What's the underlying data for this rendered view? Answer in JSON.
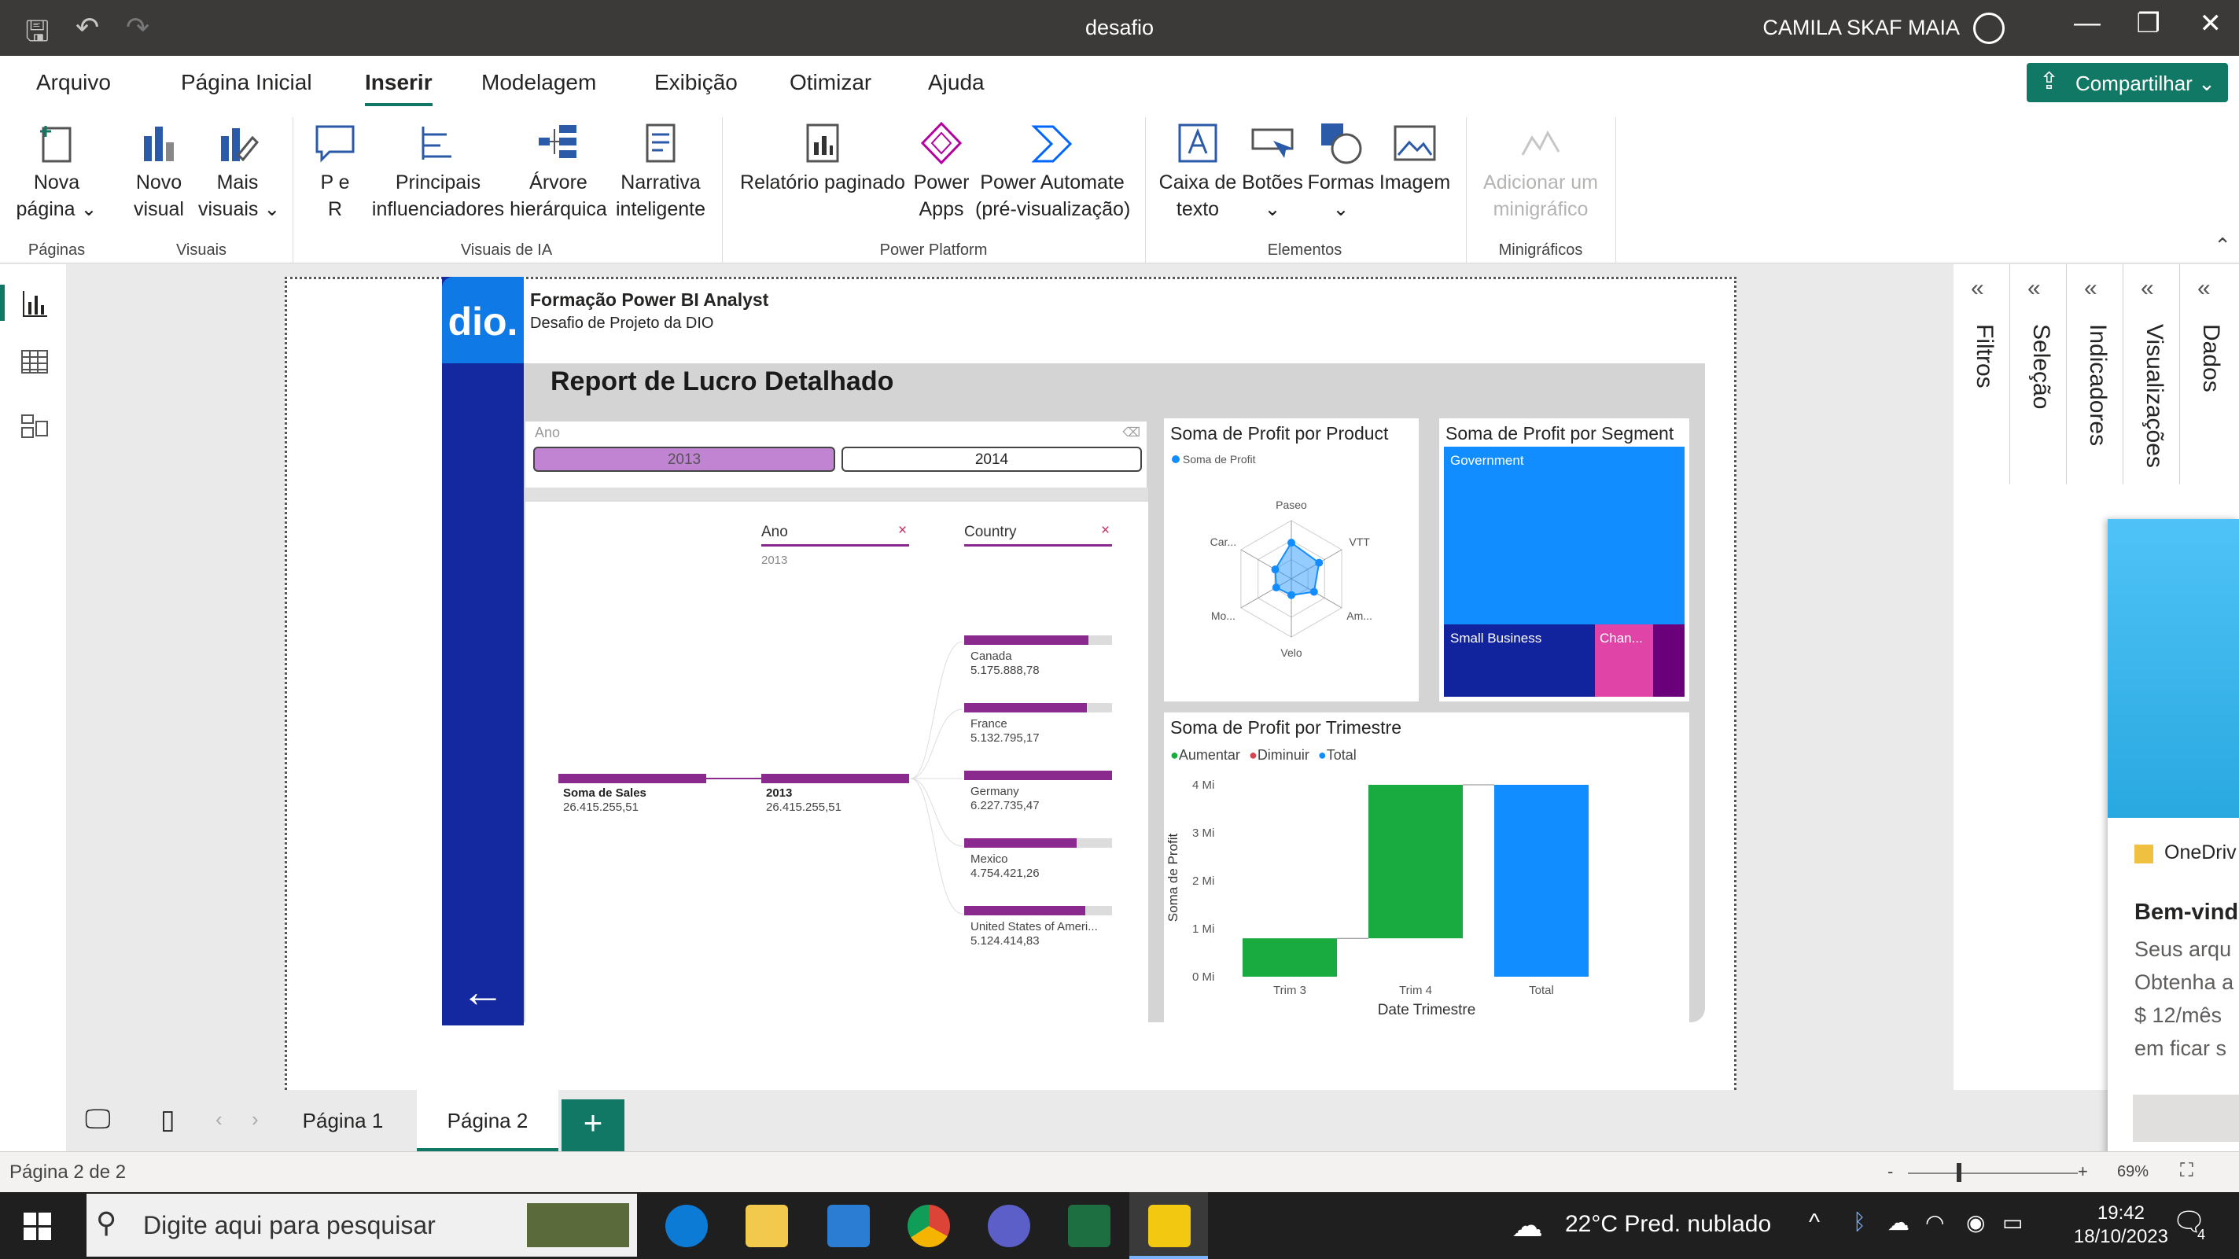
{
  "titlebar": {
    "title": "desafio",
    "user": "CAMILA SKAF MAIA"
  },
  "menu": {
    "tabs": [
      "Arquivo",
      "Página Inicial",
      "Inserir",
      "Modelagem",
      "Exibição",
      "Otimizar",
      "Ajuda"
    ],
    "active": "Inserir",
    "share_label": "Compartilhar"
  },
  "ribbon": {
    "nova_pagina": "Nova\npágina ⌄",
    "novo_visual": "Novo\nvisual",
    "mais_visuais": "Mais\nvisuais ⌄",
    "pe_r": "P e\nR",
    "principais": "Principais\ninfluenciadores",
    "arvore": "Árvore\nhierárquica",
    "narrativa": "Narrativa\ninteligente",
    "relatorio": "Relatório paginado",
    "power_apps": "Power\nApps",
    "power_automate": "Power Automate\n(pré-visualização)",
    "caixa_texto": "Caixa de\ntexto",
    "botoes": "Botões\n⌄",
    "formas": "Formas\n⌄",
    "imagem": "Imagem",
    "minigrafico": "Adicionar um\nminigráfico",
    "groups": {
      "paginas": "Páginas",
      "visuais": "Visuais",
      "visuais_ia": "Visuais de IA",
      "power_platform": "Power Platform",
      "elementos": "Elementos",
      "minigraficos": "Minigráficos"
    }
  },
  "report": {
    "logo": "dio.",
    "header_title": "Formação Power BI Analyst",
    "header_sub": "Desafio de Projeto da DIO",
    "title": "Report de Lucro Detalhado",
    "slicer": {
      "label": "Ano",
      "options": [
        "2013",
        "2014"
      ],
      "selected": "2013"
    },
    "decomp": {
      "col1": "Ano",
      "col1_value": "2013",
      "col2": "Country",
      "root": {
        "label": "Soma de Sales",
        "value": "26.415.255,51"
      },
      "level1": {
        "label": "2013",
        "value": "26.415.255,51"
      },
      "countries": [
        {
          "name": "Canada",
          "value": "5.175.888,78",
          "fraction": 0.84
        },
        {
          "name": "France",
          "value": "5.132.795,17",
          "fraction": 0.83
        },
        {
          "name": "Germany",
          "value": "6.227.735,47",
          "fraction": 1.0
        },
        {
          "name": "Mexico",
          "value": "4.754.421,26",
          "fraction": 0.76
        },
        {
          "name": "United States of Ameri...",
          "value": "5.124.414,83",
          "fraction": 0.82
        }
      ]
    },
    "radar": {
      "title": "Soma de Profit por Product",
      "legend": "Soma de Profit",
      "axes": [
        "Paseo",
        "VTT",
        "Am...",
        "Velo",
        "Mo...",
        "Car..."
      ],
      "values": [
        0.62,
        0.55,
        0.45,
        0.28,
        0.3,
        0.32
      ],
      "color": "#118dff"
    },
    "treemap": {
      "title": "Soma de Profit por Segment",
      "items": [
        {
          "name": "Government",
          "color": "#118dff"
        },
        {
          "name": "Small Business",
          "color": "#12239e"
        },
        {
          "name": "Chan...",
          "color": "#e044a7"
        },
        {
          "name": "",
          "color": "#6b007b"
        }
      ]
    },
    "waterfall": {
      "title": "Soma de Profit por Trimestre",
      "legend": [
        {
          "name": "Aumentar",
          "color": "#1aab40"
        },
        {
          "name": "Diminuir",
          "color": "#d64550"
        },
        {
          "name": "Total",
          "color": "#118dff"
        }
      ],
      "ylabel": "Soma de Profit",
      "xlabel": "Date Trimestre",
      "yticks": [
        "0 Mi",
        "1 Mi",
        "2 Mi",
        "3 Mi",
        "4 Mi"
      ]
    }
  },
  "chart_data": {
    "type": "bar",
    "title": "Soma de Profit por Trimestre",
    "categories": [
      "Trim 3",
      "Trim 4",
      "Total"
    ],
    "series": [
      {
        "name": "Aumentar",
        "values": [
          [
            0,
            0.8
          ],
          [
            0.8,
            4.0
          ],
          null
        ]
      },
      {
        "name": "Total",
        "values": [
          null,
          null,
          [
            0,
            4.0
          ]
        ]
      }
    ],
    "xlabel": "Date Trimestre",
    "ylabel": "Soma de Profit",
    "ylim": [
      0,
      4
    ]
  },
  "panes": [
    "Filtros",
    "Seleção",
    "Indicadores",
    "Visualizações",
    "Dados"
  ],
  "pages": {
    "tabs": [
      "Página 1",
      "Página 2"
    ],
    "active": "Página 2",
    "add": "+"
  },
  "status": {
    "text": "Página 2 de 2",
    "zoom": "69%"
  },
  "onedrive": {
    "name": "OneDriv",
    "heading": "Bem-vind",
    "lines": [
      "Seus arqu",
      "Obtenha a",
      "$ 12/mês",
      "em ficar s"
    ]
  },
  "taskbar": {
    "search": "Digite aqui para pesquisar",
    "weather": "22°C  Pred. nublado",
    "time": "19:42",
    "date": "18/10/2023",
    "notif": "4"
  }
}
